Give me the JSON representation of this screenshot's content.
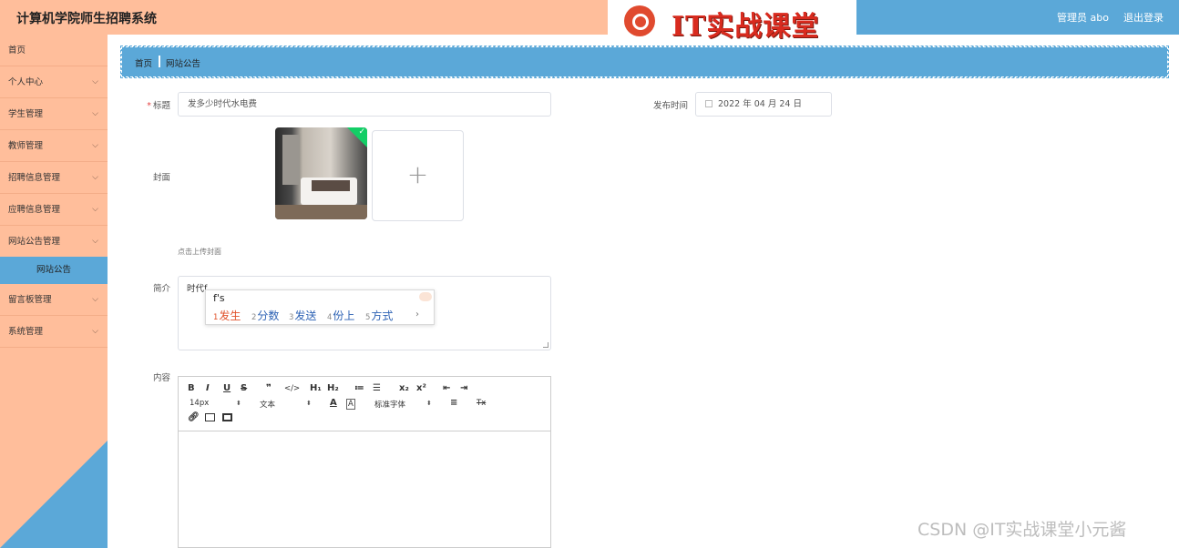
{
  "header": {
    "system_title": "计算机学院师生招聘系统",
    "logo_text": "IT实战课堂",
    "admin_label": "管理员 abo",
    "logout_label": "退出登录",
    "left_color": "#ffbe9b",
    "right_color": "#5ba8d8"
  },
  "sidebar": {
    "items": [
      {
        "label": "首页",
        "has_chevron": false
      },
      {
        "label": "个人中心",
        "has_chevron": true
      },
      {
        "label": "学生管理",
        "has_chevron": true
      },
      {
        "label": "教师管理",
        "has_chevron": true
      },
      {
        "label": "招聘信息管理",
        "has_chevron": true
      },
      {
        "label": "应聘信息管理",
        "has_chevron": true
      },
      {
        "label": "网站公告管理",
        "has_chevron": true
      },
      {
        "label": "留言板管理",
        "has_chevron": true
      },
      {
        "label": "系统管理",
        "has_chevron": true
      }
    ],
    "active_sub": "网站公告",
    "chevron_icon": "chevron-down-icon"
  },
  "breadcrumb": {
    "home": "首页",
    "current": "网站公告"
  },
  "form": {
    "title_label": "标题",
    "title_value": "发多少时代水电费",
    "publish_label": "发布时间",
    "publish_value": "2022 年 04 月 24 日",
    "cover_label": "封面",
    "cover_hint": "点击上传封面",
    "intro_label": "简介",
    "intro_value": "时代f",
    "content_label": "内容"
  },
  "ime": {
    "pinyin": "f's",
    "candidates": [
      {
        "num": "1",
        "text": "发生"
      },
      {
        "num": "2",
        "text": "分数"
      },
      {
        "num": "3",
        "text": "发送"
      },
      {
        "num": "4",
        "text": "份上"
      },
      {
        "num": "5",
        "text": "方式"
      }
    ],
    "next_arrow": "›"
  },
  "editor": {
    "row1": [
      "B",
      "I",
      "U",
      "S",
      "❞",
      "</>",
      "H₁",
      "H₂",
      "≔",
      "☰",
      "x₂",
      "x²",
      "⇤",
      "⇥"
    ],
    "font_size": "14px",
    "text_type": "文本",
    "font_family": "标准字体",
    "clear_format": "Tx"
  },
  "watermark": "CSDN @IT实战课堂小元酱"
}
